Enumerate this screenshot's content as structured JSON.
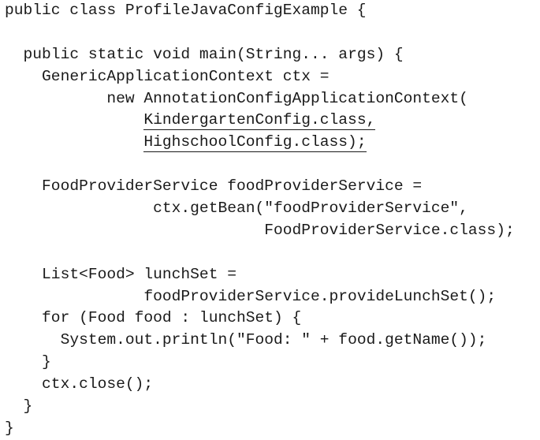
{
  "code": {
    "lines": [
      {
        "indent": "",
        "text": "public class ProfileJavaConfigExample {",
        "underline": ""
      },
      {
        "indent": "",
        "text": "",
        "underline": ""
      },
      {
        "indent": "  ",
        "text": "public static void main(String... args) {",
        "underline": ""
      },
      {
        "indent": "    ",
        "text": "GenericApplicationContext ctx =",
        "underline": ""
      },
      {
        "indent": "           ",
        "text": "new AnnotationConfigApplicationContext(",
        "underline": ""
      },
      {
        "indent": "               ",
        "text": "",
        "underline": "KindergartenConfig.class,"
      },
      {
        "indent": "               ",
        "text": "",
        "underline": "HighschoolConfig.class);"
      },
      {
        "indent": "",
        "text": "",
        "underline": ""
      },
      {
        "indent": "    ",
        "text": "FoodProviderService foodProviderService =",
        "underline": ""
      },
      {
        "indent": "                ",
        "text": "ctx.getBean(\"foodProviderService\",",
        "underline": ""
      },
      {
        "indent": "                            ",
        "text": "FoodProviderService.class);",
        "underline": ""
      },
      {
        "indent": "",
        "text": "",
        "underline": ""
      },
      {
        "indent": "    ",
        "text": "List<Food> lunchSet =",
        "underline": ""
      },
      {
        "indent": "               ",
        "text": "foodProviderService.provideLunchSet();",
        "underline": ""
      },
      {
        "indent": "    ",
        "text": "for (Food food : lunchSet) {",
        "underline": ""
      },
      {
        "indent": "      ",
        "text": "System.out.println(\"Food: \" + food.getName());",
        "underline": ""
      },
      {
        "indent": "    ",
        "text": "}",
        "underline": ""
      },
      {
        "indent": "    ",
        "text": "ctx.close();",
        "underline": ""
      },
      {
        "indent": "  ",
        "text": "}",
        "underline": ""
      },
      {
        "indent": "",
        "text": "}",
        "underline": ""
      }
    ]
  }
}
